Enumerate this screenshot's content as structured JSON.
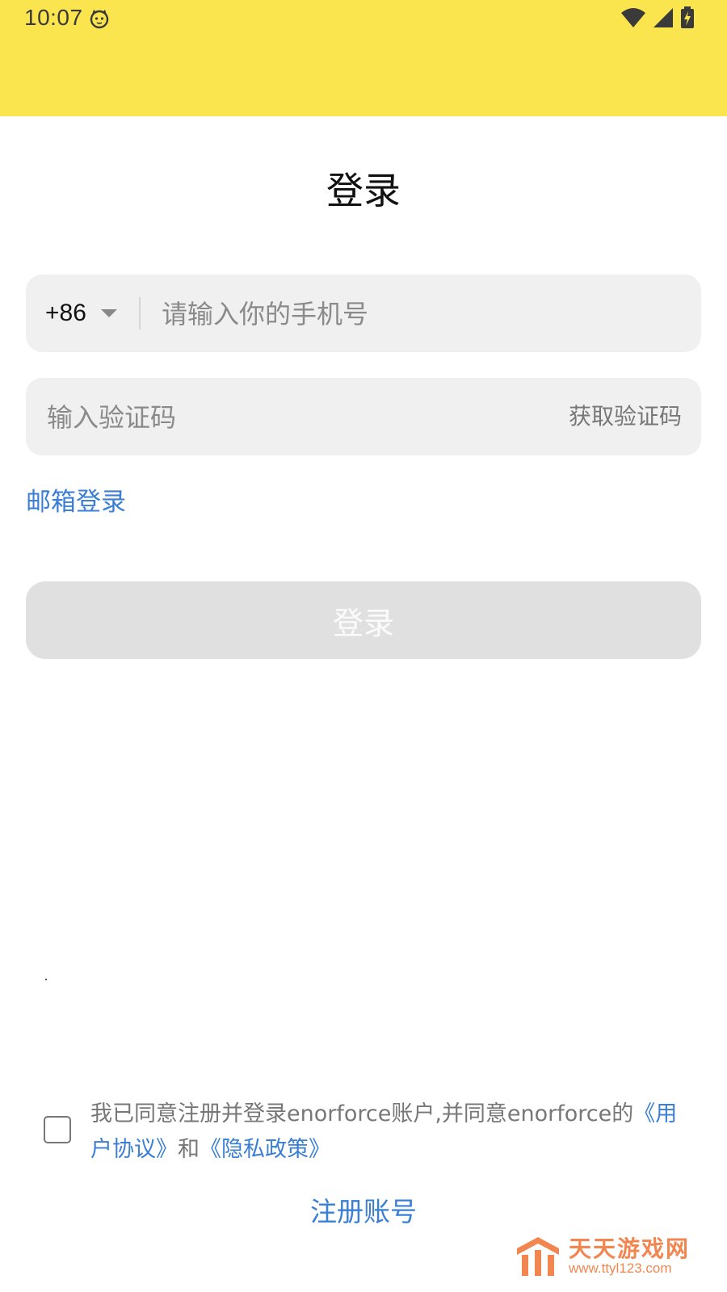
{
  "status_bar": {
    "time": "10:07",
    "icons": [
      "cat-notification-icon",
      "wifi-icon",
      "signal-icon",
      "battery-charging-icon"
    ],
    "background_color": "#fbe54f"
  },
  "page": {
    "title": "登录"
  },
  "phone_field": {
    "country_code": "+86",
    "placeholder": "请输入你的手机号",
    "value": ""
  },
  "code_field": {
    "placeholder": "输入验证码",
    "value": "",
    "get_code_label": "获取验证码"
  },
  "email_login_label": "邮箱登录",
  "login_button": {
    "label": "登录",
    "enabled": false
  },
  "agreement": {
    "checked": false,
    "text_prefix": "我已同意注册并登录enorforce账户,并同意enorforce的",
    "user_agreement": "《用户协议》",
    "connector": "和",
    "privacy_policy": "《隐私政策》"
  },
  "register_label": "注册账号",
  "watermark": {
    "name": "天天游戏网",
    "url": "www.ttyl123.com"
  },
  "colors": {
    "accent": "#3a7fd5",
    "header": "#fbe54f",
    "field_bg": "#f0f0f0",
    "button_disabled": "#e0e0e0"
  }
}
